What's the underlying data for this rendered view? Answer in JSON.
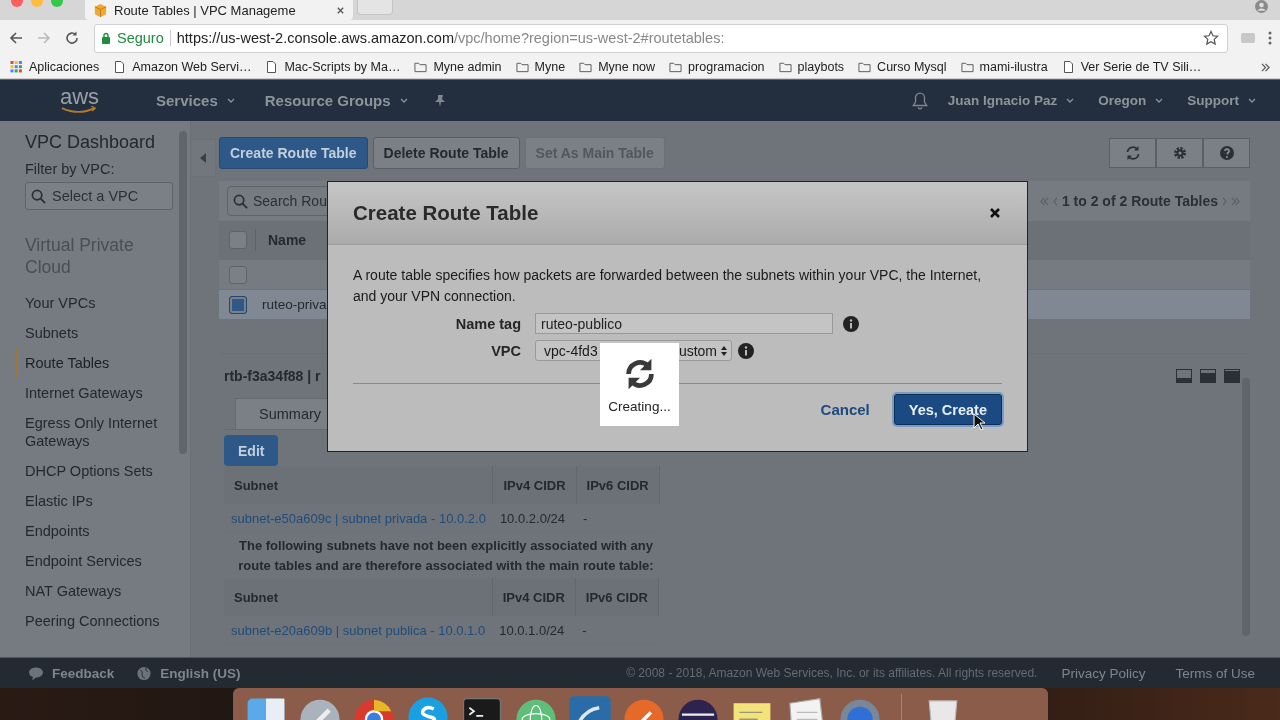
{
  "browser": {
    "tab_title": "Route Tables | VPC Manageme",
    "secure_label": "Seguro",
    "url_host": "https://us-west-2.console.aws.amazon.com",
    "url_path": "/vpc/home?region=us-west-2#routetables:",
    "bookmarks": [
      {
        "kind": "apps",
        "label": "Aplicaciones"
      },
      {
        "kind": "page",
        "label": "Amazon Web Servi…"
      },
      {
        "kind": "page",
        "label": "Mac-Scripts by Ma…"
      },
      {
        "kind": "folder",
        "label": "Myne admin"
      },
      {
        "kind": "folder",
        "label": "Myne"
      },
      {
        "kind": "folder",
        "label": "Myne now"
      },
      {
        "kind": "folder",
        "label": "programacion"
      },
      {
        "kind": "folder",
        "label": "playbots"
      },
      {
        "kind": "folder",
        "label": "Curso Mysql"
      },
      {
        "kind": "folder",
        "label": "mami-ilustra"
      },
      {
        "kind": "page",
        "label": "Ver Serie de TV Sili…"
      }
    ]
  },
  "nav": {
    "logo": "aws",
    "menus": [
      "Services",
      "Resource Groups"
    ],
    "right_menus": [
      "Juan Ignacio Paz",
      "Oregon",
      "Support"
    ]
  },
  "sidebar": {
    "title": "VPC Dashboard",
    "filter_label": "Filter by VPC:",
    "filter_placeholder": "Select a VPC",
    "section": "Virtual Private Cloud",
    "items": [
      {
        "label": "Your VPCs",
        "selected": false
      },
      {
        "label": "Subnets",
        "selected": false
      },
      {
        "label": "Route Tables",
        "selected": true
      },
      {
        "label": "Internet Gateways",
        "selected": false
      },
      {
        "label": "Egress Only Internet Gateways",
        "selected": false
      },
      {
        "label": "DHCP Options Sets",
        "selected": false
      },
      {
        "label": "Elastic IPs",
        "selected": false
      },
      {
        "label": "Endpoints",
        "selected": false
      },
      {
        "label": "Endpoint Services",
        "selected": false
      },
      {
        "label": "NAT Gateways",
        "selected": false
      },
      {
        "label": "Peering Connections",
        "selected": false
      }
    ]
  },
  "toolbar": {
    "buttons": [
      {
        "label": "Create Route Table",
        "kind": "primary",
        "disabled": false
      },
      {
        "label": "Delete Route Table",
        "kind": "default",
        "disabled": false
      },
      {
        "label": "Set As Main Table",
        "kind": "default",
        "disabled": true
      }
    ]
  },
  "list": {
    "search_placeholder": "Search Rou",
    "pagination": "1 to 2 of 2 Route Tables",
    "header_checked": false,
    "columns": [
      "Name"
    ],
    "rows": [
      {
        "selected": false
      },
      {
        "name": "ruteo-priva",
        "selected": true
      }
    ]
  },
  "detail": {
    "title": "rtb-f3a34f88 | r",
    "tabs": [
      {
        "label": "Summary",
        "selected": false
      }
    ],
    "edit_button": "Edit",
    "associated": {
      "columns": [
        "Subnet",
        "IPv4 CIDR",
        "IPv6 CIDR"
      ],
      "rows": [
        [
          "subnet-e50a609c | subnet privada - 10.0.2.0",
          "10.0.2.0/24",
          "-"
        ]
      ]
    },
    "note": "The following subnets have not been explicitly associated with any route tables and are therefore associated with the main route table:",
    "unassociated": {
      "columns": [
        "Subnet",
        "IPv4 CIDR",
        "IPv6 CIDR"
      ],
      "rows": [
        [
          "subnet-e20a609b | subnet publica - 10.0.1.0",
          "10.0.1.0/24",
          "-"
        ]
      ]
    }
  },
  "modal": {
    "title": "Create Route Table",
    "description": "A route table specifies how packets are forwarded between the subnets within your VPC, the Internet, and your VPN connection.",
    "fields": [
      {
        "kind": "text",
        "label": "Name tag",
        "value": "ruteo-publico"
      },
      {
        "kind": "select",
        "label": "VPC",
        "value_start": "vpc-4fd3",
        "value_end": "ustom"
      }
    ],
    "buttons": [
      {
        "label": "Cancel",
        "kind": "link"
      },
      {
        "label": "Yes, Create",
        "kind": "primary"
      }
    ],
    "progress": "Creating..."
  },
  "footer": {
    "feedback": "Feedback",
    "language": "English (US)",
    "copyright": "© 2008 - 2018, Amazon Web Services, Inc. or its affiliates. All rights reserved.",
    "links": [
      "Privacy Policy",
      "Terms of Use"
    ]
  }
}
